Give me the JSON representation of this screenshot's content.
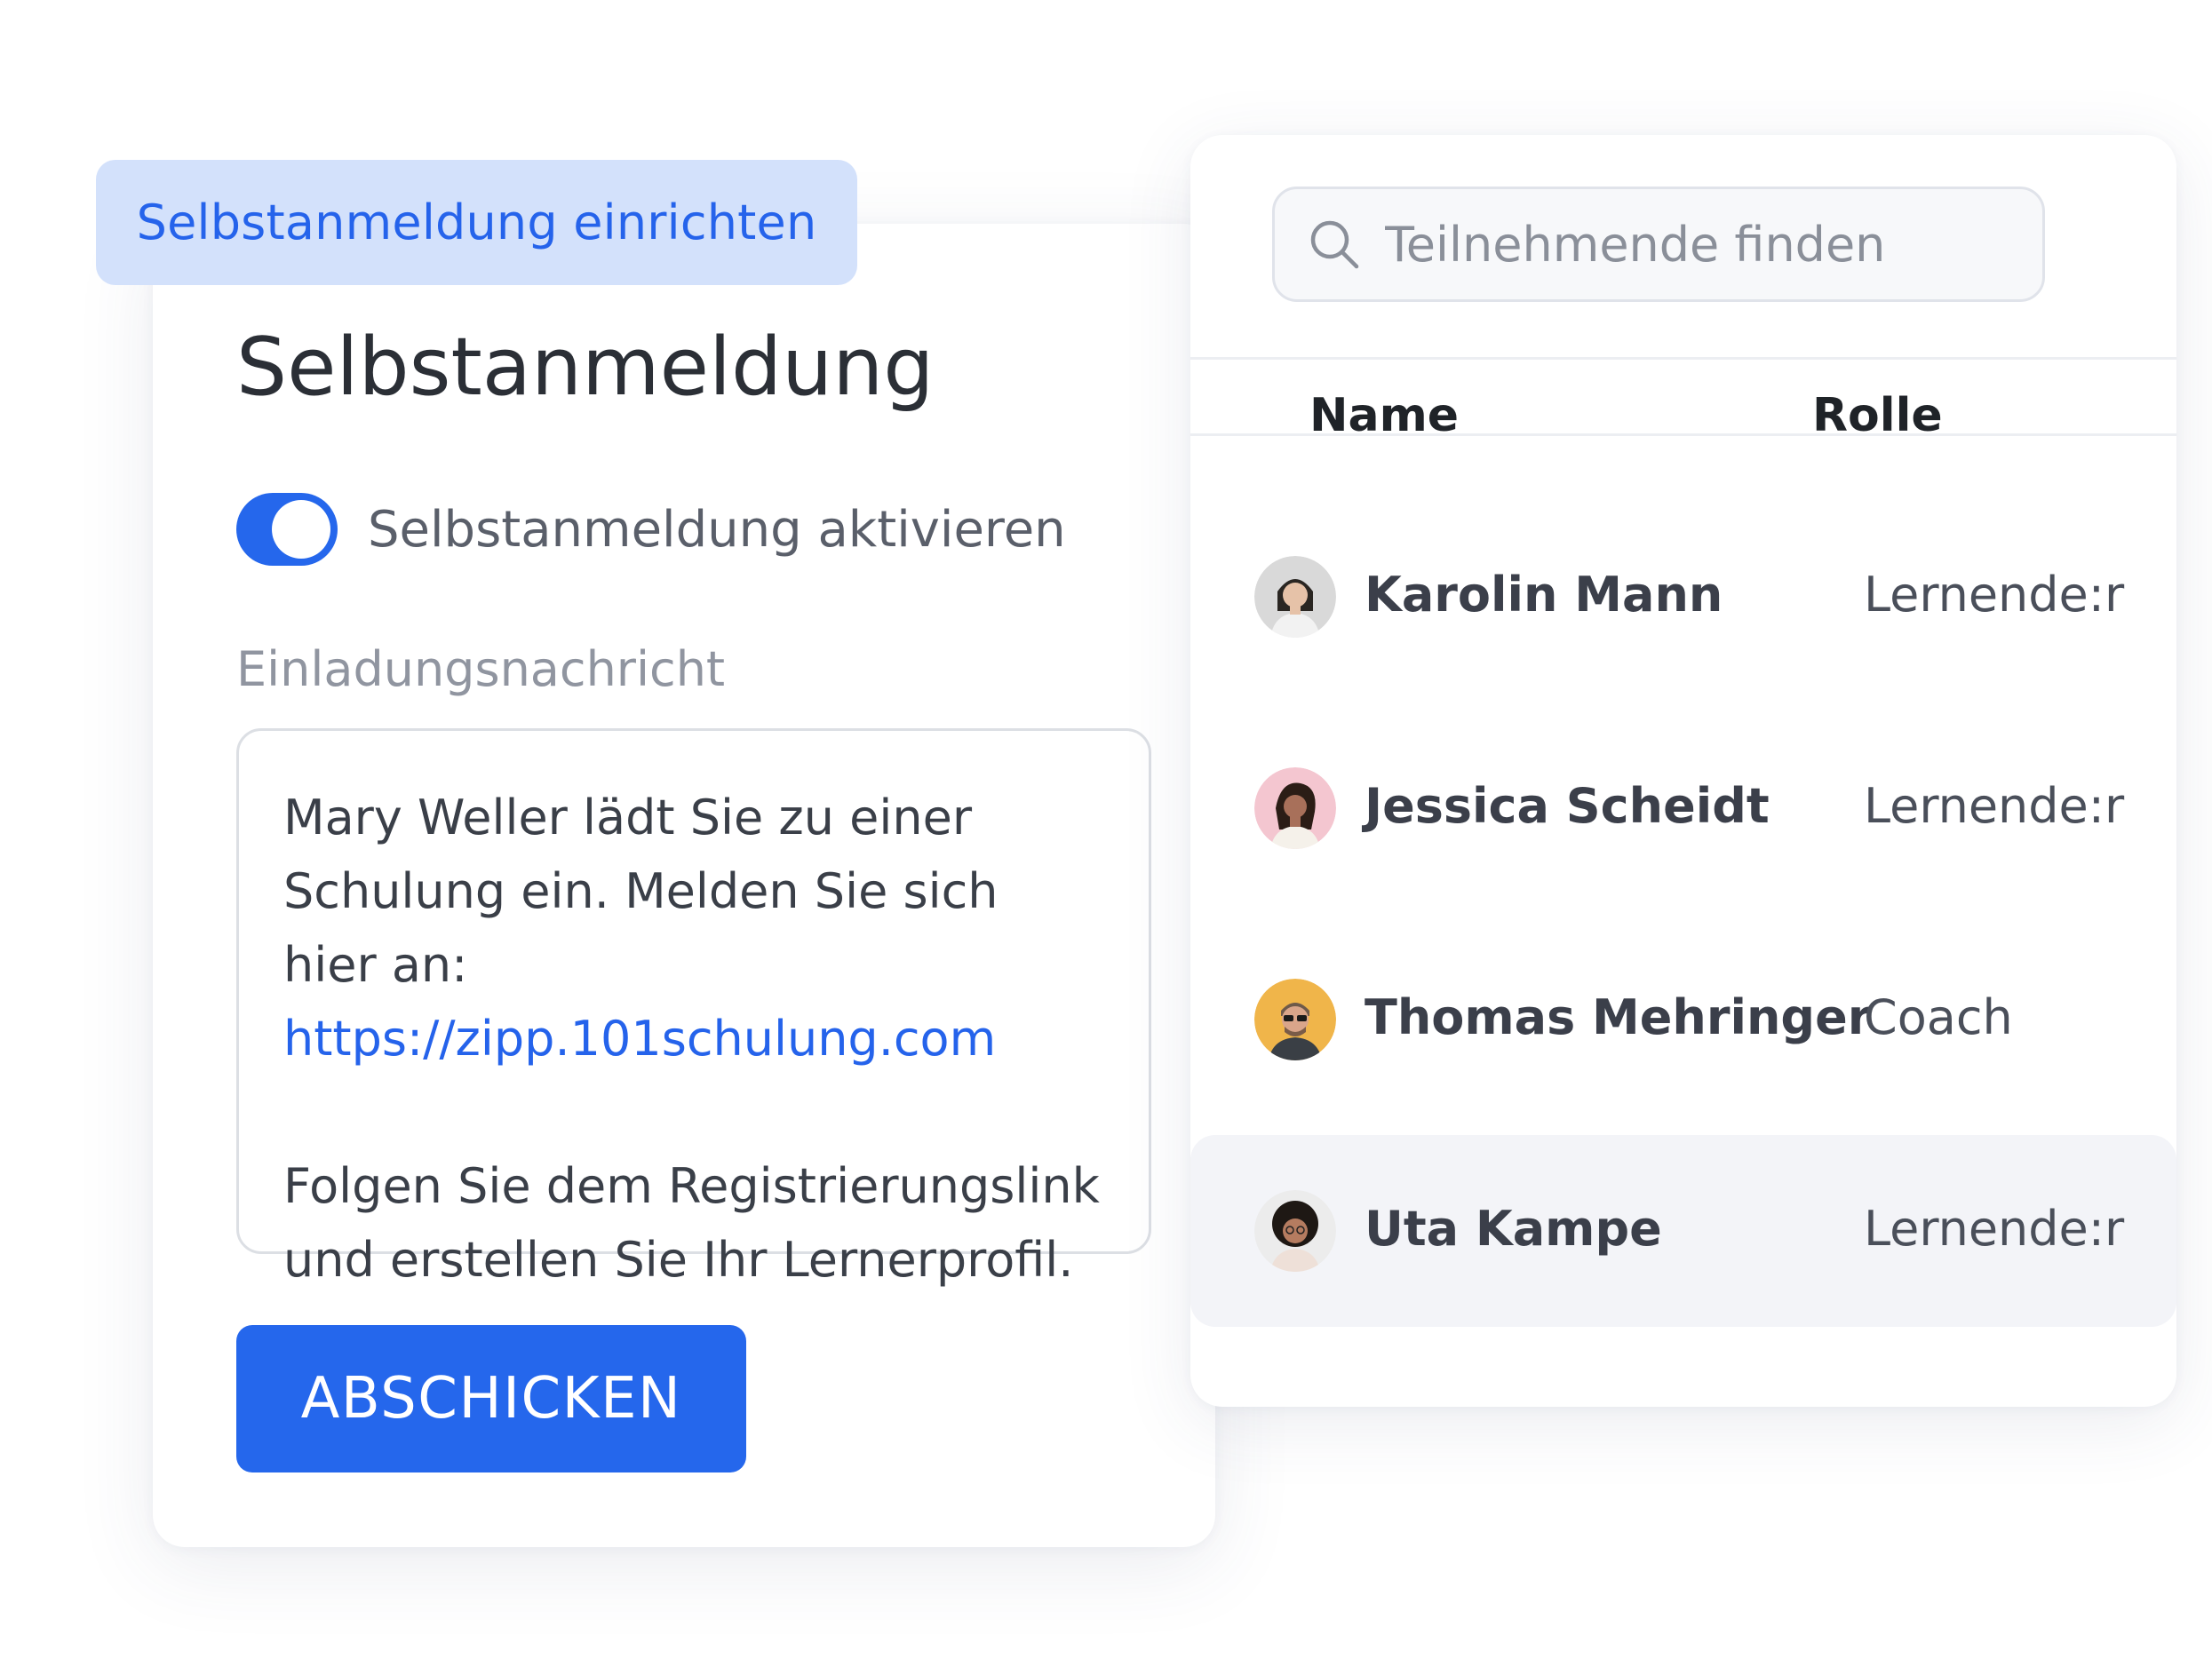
{
  "setup_tab": {
    "label": "Selbstanmeldung einrichten"
  },
  "self_registration": {
    "title": "Selbstanmeldung",
    "toggle_label": "Selbstanmeldung aktivieren",
    "toggle_on": true,
    "message_label": "Einladungsnachricht",
    "message": {
      "line1": "Mary Weller lädt Sie zu einer",
      "line2": "Schulung ein. Melden Sie sich hier an:",
      "link": "https://zipp.101schulung.com",
      "line3": "Folgen Sie dem Registrierungslink",
      "line4": "und erstellen Sie Ihr Lernerprofil."
    },
    "submit_label": "ABSCHICKEN"
  },
  "participants": {
    "search_placeholder": "Teilnehmende finden",
    "columns": {
      "name": "Name",
      "role": "Rolle"
    },
    "rows": [
      {
        "name": "Karolin Mann",
        "role": "Lernende:r",
        "avatar_bg": "#d9d9d9",
        "selected": false
      },
      {
        "name": "Jessica Scheidt",
        "role": "Lernende:r",
        "avatar_bg": "#f4c6d0",
        "selected": false
      },
      {
        "name": "Thomas Mehringer",
        "role": "Coach",
        "avatar_bg": "#f0b54a",
        "selected": false
      },
      {
        "name": "Uta Kampe",
        "role": "Lernende:r",
        "avatar_bg": "#ececec",
        "selected": true
      }
    ]
  },
  "colors": {
    "accent": "#2567ec",
    "tab_bg": "#d3e1fb",
    "selected_row_bg": "#f3f4f8"
  }
}
